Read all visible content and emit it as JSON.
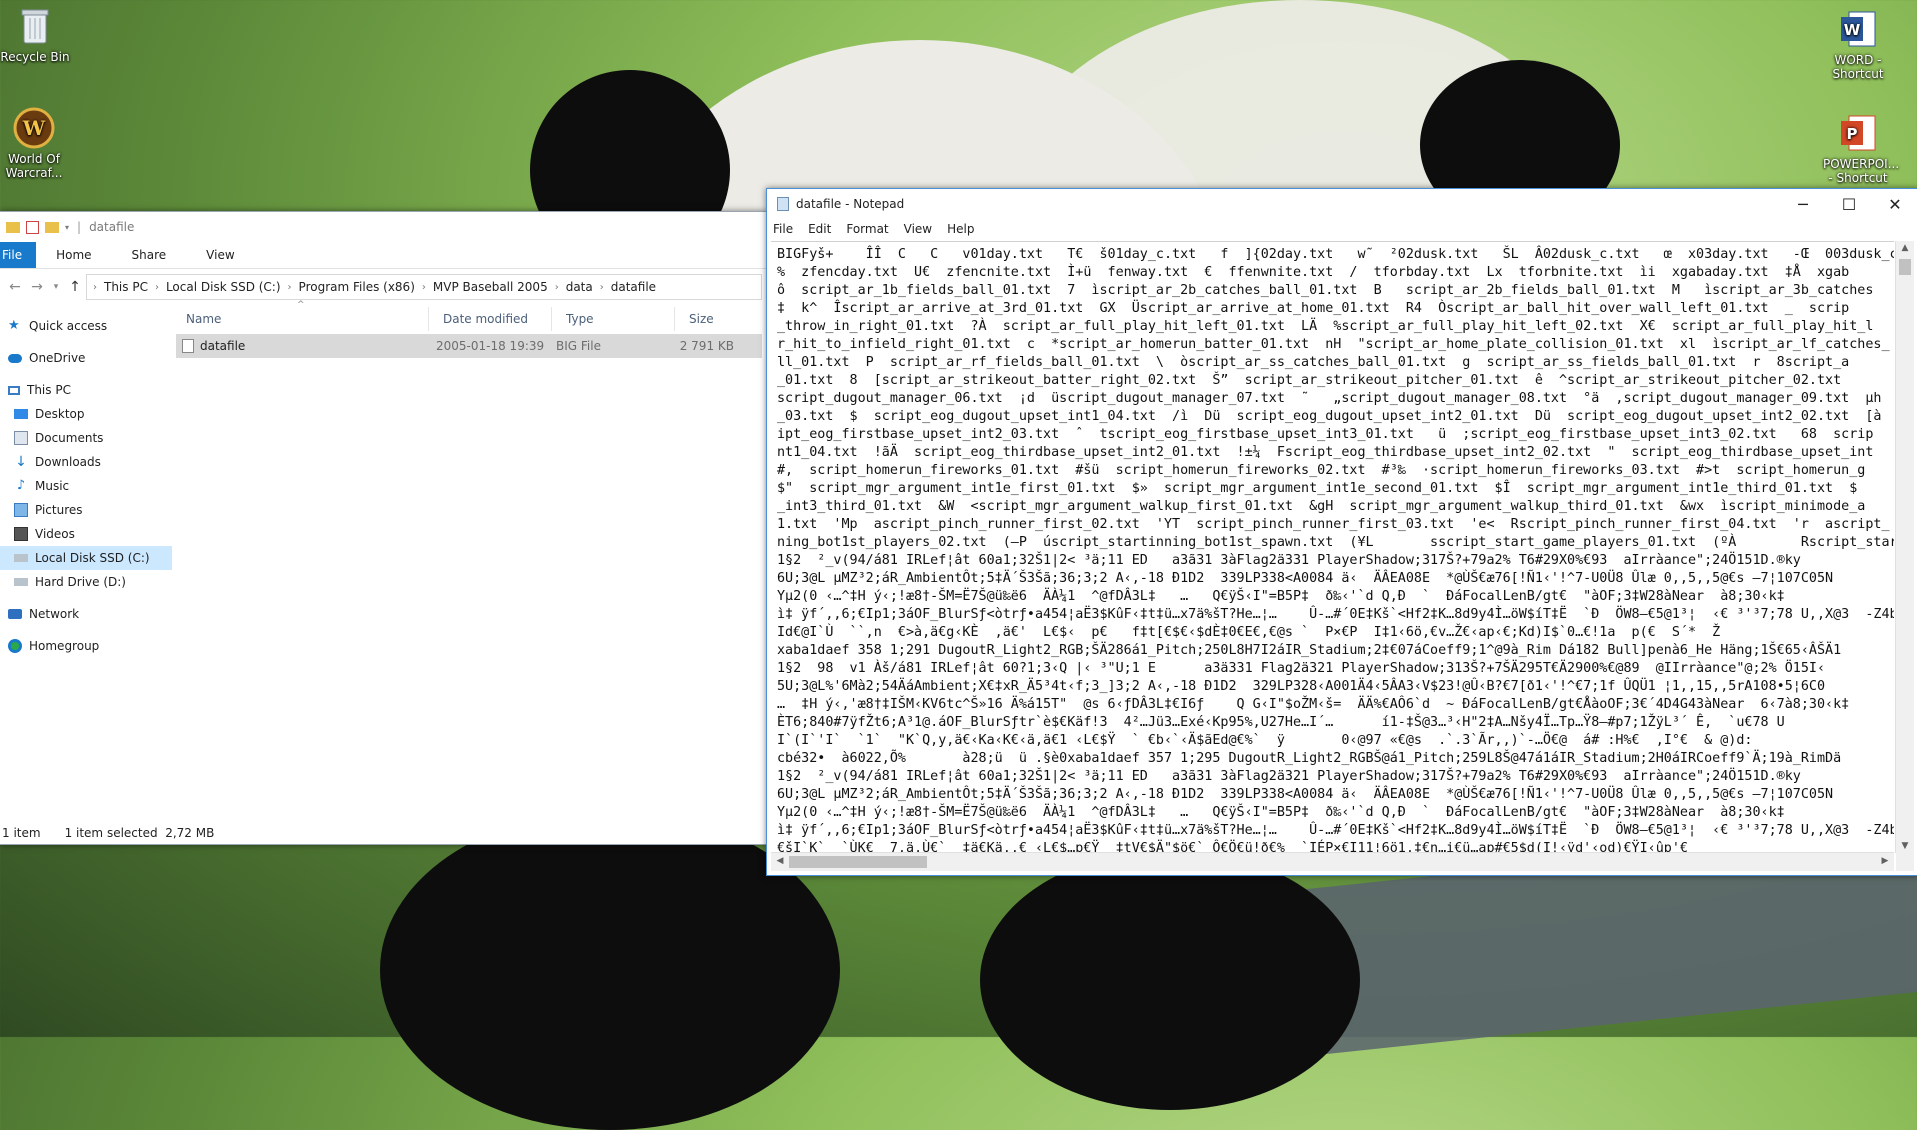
{
  "desktop": {
    "icons": [
      {
        "label": "Recycle Bin"
      },
      {
        "label": "World Of Warcraf..."
      },
      {
        "label": "WORD - Shortcut"
      },
      {
        "label": "POWERPOI... - Shortcut"
      }
    ]
  },
  "explorer": {
    "title": "datafile",
    "ribbon_tabs": [
      "File",
      "Home",
      "Share",
      "View"
    ],
    "breadcrumb": [
      "This PC",
      "Local Disk SSD (C:)",
      "Program Files (x86)",
      "MVP Baseball 2005",
      "data",
      "datafile"
    ],
    "nav": [
      {
        "label": "Quick access",
        "icon": "star-icon"
      },
      {
        "label": "OneDrive",
        "icon": "cloud-icon"
      },
      {
        "label": "This PC",
        "icon": "computer-icon"
      },
      {
        "label": "Desktop",
        "icon": "desktop-icon"
      },
      {
        "label": "Documents",
        "icon": "documents-icon"
      },
      {
        "label": "Downloads",
        "icon": "downloads-icon"
      },
      {
        "label": "Music",
        "icon": "music-icon"
      },
      {
        "label": "Pictures",
        "icon": "pictures-icon"
      },
      {
        "label": "Videos",
        "icon": "videos-icon"
      },
      {
        "label": "Local Disk SSD (C:)",
        "icon": "drive-icon"
      },
      {
        "label": "Hard Drive (D:)",
        "icon": "drive-icon"
      },
      {
        "label": "Network",
        "icon": "network-icon"
      },
      {
        "label": "Homegroup",
        "icon": "homegroup-icon"
      }
    ],
    "columns": {
      "name": "Name",
      "modified": "Date modified",
      "type": "Type",
      "size": "Size"
    },
    "files": [
      {
        "name": "datafile",
        "modified": "2005-01-18 19:39",
        "type": "BIG File",
        "size": "2 791 KB"
      }
    ],
    "status": {
      "count": "1 item",
      "selected": "1 item selected  2,72 MB"
    }
  },
  "notepad": {
    "title": "datafile - Notepad",
    "menu": [
      "File",
      "Edit",
      "Format",
      "View",
      "Help"
    ],
    "content": "BIGFyš+    ÎÎ  C   C   v01day.txt   T€  š01day_c.txt   f  ]{02day.txt   w˜  ²02dusk.txt   ŠL  Â02dusk_c.txt   œ  x03day.txt   -Œ  003dusk_c\n%  zfencday.txt  U€  zfencnite.txt  Ì+ü  fenway.txt  €  ffenwnite.txt  /  tforbday.txt  Lx  tforbnite.txt  ìi  xgabaday.txt  ‡Å  xgab\nô  script_ar_1b_fields_ball_01.txt  7  ìscript_ar_2b_catches_ball_01.txt  B   script_ar_2b_fields_ball_01.txt  M   ìscript_ar_3b_catches\n‡  k^  Îscript_ar_arrive_at_3rd_01.txt  GX  Üscript_ar_arrive_at_home_01.txt  R4  Òscript_ar_ball_hit_over_wall_left_01.txt  _  scrip\n_throw_in_right_01.txt  ?À  script_ar_full_play_hit_left_01.txt  LÄ  %script_ar_full_play_hit_left_02.txt  X€  script_ar_full_play_hit_l\nr_hit_to_infield_right_01.txt  c  *script_ar_homerun_batter_01.txt  nH  \"script_ar_home_plate_collision_01.txt  xl  ìscript_ar_lf_catches_\nll_01.txt  P  script_ar_rf_fields_ball_01.txt  \\  òscript_ar_ss_catches_ball_01.txt  g  script_ar_ss_fields_ball_01.txt  r  8script_a\n_01.txt  8  [script_ar_strikeout_batter_right_02.txt  Š”  script_ar_strikeout_pitcher_01.txt  ê  ^script_ar_strikeout_pitcher_02.txt\nscript_dugout_manager_06.txt  ¡d  üscript_dugout_manager_07.txt  ˜   „script_dugout_manager_08.txt  °ä  ,script_dugout_manager_09.txt  µh\n_03.txt  $  script_eog_dugout_upset_int1_04.txt  /ì  Dü  script_eog_dugout_upset_int2_01.txt  Dü  script_eog_dugout_upset_int2_02.txt  [à\nipt_eog_firstbase_upset_int2_03.txt  ˆ  tscript_eog_firstbase_upset_int3_01.txt   ü  ;script_eog_firstbase_upset_int3_02.txt   68  scrip\nnt1_04.txt  !ãÄ  script_eog_thirdbase_upset_int2_01.txt  !±¼  Fscript_eog_thirdbase_upset_int2_02.txt  \"  script_eog_thirdbase_upset_int\n#,  script_homerun_fireworks_01.txt  #šü  script_homerun_fireworks_02.txt  #³‰  ·script_homerun_fireworks_03.txt  #>t  script_homerun_g\n$\"  script_mgr_argument_int1e_first_01.txt  $»  script_mgr_argument_int1e_second_01.txt  $Î  script_mgr_argument_int1e_third_01.txt  $\n_int3_third_01.txt  &W  <script_mgr_argument_walkup_first_01.txt  &gH  script_mgr_argument_walkup_third_01.txt  &wx  ìscript_minimode_a\n1.txt  'Mp  ascript_pinch_runner_first_02.txt  'YT  script_pinch_runner_first_03.txt  'e<  Rscript_pinch_runner_first_04.txt  'r  ascript_\nning_bot1st_players_02.txt  (—P  úscript_startinning_bot1st_spawn.txt  (¥L       sscript_start_game_players_01.txt  (ºÀ        Rscript_star\n1§2  ²_v(94/á81 IRLef¦ât 60a1;32Š1|2< ³ä;11 ED   a3ã31 3àFlag2ä331 PlayerShadow;317Š?+79a2% T6#29X0%€93  aIrràance\";24Ö151D.®ky\n6U;3@L µMZ³2;áR_AmbientÔt;5‡Ä´Š3Šã;36;3;2 A‹,-18 Ð1D2  339LP338<A0084 ä‹  ÄÂEA08E  *@ÙŠ€æ76[!Ñ1‹'!^7-U0Ü8 Ûlæ 0,,5,,5@€s –7¦107C05N\nYµ2(0 ‹…^‡H ý‹;!æ8†-ŠM=Ë7Š@ü‰ë6  ÄÀ¼1  ^@fDÂ3L‡   …   Q€ÿŠ‹I\"=B5P‡  ð‰‹'`d Q,Ð  `  ÐáFocalLenB/gt€  \"àOF;3‡W28àNear  à8;30‹k‡\nì‡ ÿf´,,6;€Ip1;3áOF_BlurSƒ<òtrƒ•a454¦aË3$KûF‹‡t‡ü…x7ä%šT?He…¦…    Û-…#´0E‡Kš`<Hf2‡K…8d9y4Ì…öW$íT‡Ë  `Ð  ÖW8–€5@1³¦  ‹€ ³'³7;78 U,,X@3  -Z4by2;€\nId€@I`Ù  ``,n  €>à,ä€g‹KÈ  ,ä€'  L€$‹  p€   f‡t[€$€‹$dÈ‡0€E€,€@s `  P×€P  I‡1‹6ö,€v…Ž€‹ap‹€;Kd)I$`0…€!1a  p(€  S´*  Ž\nxaba1daef 358 1;291 DugoutR_Light2_RGB;ŠÄ286á1_Pitch;250L8H7I2áIR_Stadium;2‡€07áCoeff9;1^@9à_Rim Dá182 Bull]penà6_He Häng;1Š€65‹ÂŠÄ1\n1§2  98  v1 Àš/á81 IRLef¦ât 60?1;3‹Q |‹ ³\"U;1 E      a3ä331 Flag2ä321 PlayerShadow;313Š?+7ŠÄ295T€Ä2900%€@89  @IIrràance\"@;2% Ö15I‹\n5U;3@L%'6Mà2;54ÄáAmbient;X€‡xR_Ä5³4t‹f;3_]3;2 A‹,-18 Ð1D2  329LP328‹A001Ä4‹5ÂA3‹V$23!@Û‹B?€7[ð1‹'!^€7;1f ÛQÜ1 ¦1,,15,,5rA108•5¦6C0\n…  ‡H ý‹,'æ8†‡IŠM‹KV6tc^Š»16 Ä%á15T\"  @s 6‹ƒDÂ3L‡€I6ƒ    Q G‹I\"$oŽM‹š=  ÄÄ%€AÔ6`d  ~ ÐáFocalLenB/gt€ÅàoOF;3€´4D4G43àNear  6‹7à8;30‹k‡\nÈT6;840#7ÿfŽt6;A³1@.áOF_BlurSƒtr`è$€Käf!3  4²…Jü3…Exé‹Kp95%,U27He…I´…      í1-‡Š@3…³‹H\"2‡A…Nšy4Ï…Tp…Ÿ8–#p7;1ŽÿL³´ Ê,  `u€78 U\nI`(I`'I`  `1`  \"K`Q,y,ä€‹Ka‹K€‹ä,ä€1 ‹L€$Ÿ  ` €b‹`‹Ä$ãEd@€%`  ÿ       0‹@97 «€@s  .`.3`Ãr,,)`-…Ö€@  á# :H%€  ,I°€  & @)d:\ncbé32•  à6022,Õ%       à28;ü  ü .§è0xaba1daef 357 1;295 DugoutR_Light2_RGBŠ@á1_Pitch;259L8Š@47á1áIR_Stadium;2H0áIRCoeff9`Ä;19à_RimDä\n1§2  ²_v(94/á81 IRLef¦ât 60a1;32Š1|2< ³ä;11 ED   a3ã31 3àFlag2ä321 PlayerShadow;317Š?+79a2% T6#29X0%€93  aIrràance\";24Ö151D.®ky\n6U;3@L µMZ³2;áR_AmbientÔt;5‡Ä´Š3Šã;36;3;2 A‹,-18 Ð1D2  339LP338<A0084 ä‹  ÄÂEA08E  *@ÙŠ€æ76[!Ñ1‹'!^7-U0Ü8 Ûlæ 0,,5,,5@€s –7¦107C05N\nYµ2(0 ‹…^‡H ý‹;!æ8†-ŠM=Ë7Š@ü‰ë6  ÄÀ¼1  ^@fDÂ3L‡   …   Q€ÿŠ‹I\"=B5P‡  ð‰‹'`d Q,Ð  `  ÐáFocalLenB/gt€  \"àOF;3‡W28àNear  à8;30‹k‡\nì‡ ÿf´,,6;€Ip1;3áOF_BlurSƒ<òtrƒ•a454¦aË3$KûF‹‡t‡ü…x7ä%šT?He…¦…    Û-…#´0E‡Kš`<Hf2‡K…8d9y4Ì…öW$íT‡Ë  `Ð  ÖW8–€5@1³¦  ‹€ ³'³7;78 U,,X@3  -Z4by2;€\n€šI`K`  `ÙK€  7,ä,Ù€`  ‡ä€Kä,,€ ‹L€$…p€Ÿ  ‡tV€$Ä\"$ö€` Ô€Ö€ü!ð€%  `IÉP×€I11¦6ö1,‡€n…i€ü…ap#€5$d(I!‹ÿd'‹od)€ŸI‹ûp'€"
  }
}
